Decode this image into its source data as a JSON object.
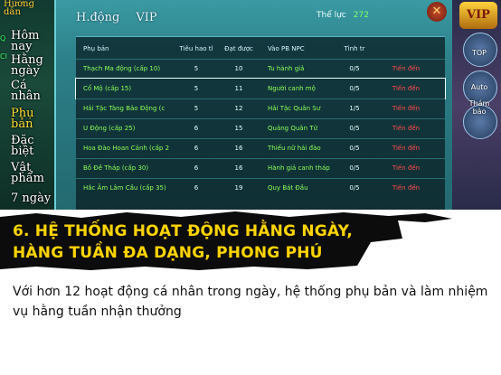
{
  "left_menu": {
    "top_label": "Hướng\ndẫn",
    "ribbon_a": "Q",
    "ribbon_b": "CI",
    "items": [
      {
        "label": "Hôm\nnay"
      },
      {
        "label": "Hằng\nngày"
      },
      {
        "label": "Cá\nnhân"
      },
      {
        "label": "Phụ\nbản",
        "active": true
      },
      {
        "label": "Đặc\nbiệt"
      },
      {
        "label": "Vật\nphẩm"
      },
      {
        "label": "7 ngày"
      }
    ]
  },
  "panel": {
    "tabs": [
      "H.động",
      "VIP"
    ],
    "stamina_label": "Thể lực",
    "stamina_value": "272",
    "close_icon": "close-icon"
  },
  "table": {
    "headers": [
      "Phụ bản",
      "Tiêu hao tl",
      "Đạt được",
      "Vào PB NPC",
      "Tình tr",
      ""
    ],
    "rows": [
      {
        "name": "Thạch Ma động (cấp 10)",
        "cost": "5",
        "gain": "10",
        "npc": "Tu hành giả",
        "status": "0/5",
        "action": "Tiến đến"
      },
      {
        "name": "Cổ Mộ (cấp 15)",
        "cost": "5",
        "gain": "11",
        "npc": "Người canh mộ",
        "status": "0/5",
        "action": "Tiến đến",
        "selected": true
      },
      {
        "name": "Hải Tặc Tàng Bảo Động (c",
        "cost": "5",
        "gain": "12",
        "npc": "Hải Tặc Quân Sư",
        "status": "1/5",
        "action": "Tiến đến"
      },
      {
        "name": "U Động (cấp 25)",
        "cost": "6",
        "gain": "15",
        "npc": "Quảng Quân Tử",
        "status": "0/5",
        "action": "Tiến đến"
      },
      {
        "name": "Hoa Đào Hoan Cảnh (cấp 2",
        "cost": "6",
        "gain": "16",
        "npc": "Thiếu nữ hái đào",
        "status": "0/5",
        "action": "Tiến đến"
      },
      {
        "name": "Bồ Đề Tháp (cấp 30)",
        "cost": "6",
        "gain": "16",
        "npc": "Hành giả canh tháp",
        "status": "0/5",
        "action": "Tiến đến"
      },
      {
        "name": "Hắc Âm Lâm Cầu (cấp 35)",
        "cost": "6",
        "gain": "19",
        "npc": "Quy Bát Đầu",
        "status": "0/5",
        "action": "Tiến đến"
      }
    ]
  },
  "right_col": {
    "vip": "VIP",
    "buttons": [
      {
        "label": "TOP",
        "icon": "top-icon"
      },
      {
        "label": "Auto",
        "icon": "auto-icon"
      },
      {
        "label": "Thám\nbảo",
        "icon": "treasure-icon"
      }
    ]
  },
  "banner": {
    "line1": "6. HỆ THỐNG HOẠT ĐỘNG HẰNG NGÀY,",
    "line2": "HÀNG TUẦN ĐA DẠNG, PHONG PHÚ",
    "color": "#ffd400"
  },
  "description": "Với hơn 12 hoạt động cá nhân trong ngày, hệ thống phụ bản và làm nhiệm vụ hằng tuần nhận thưởng"
}
